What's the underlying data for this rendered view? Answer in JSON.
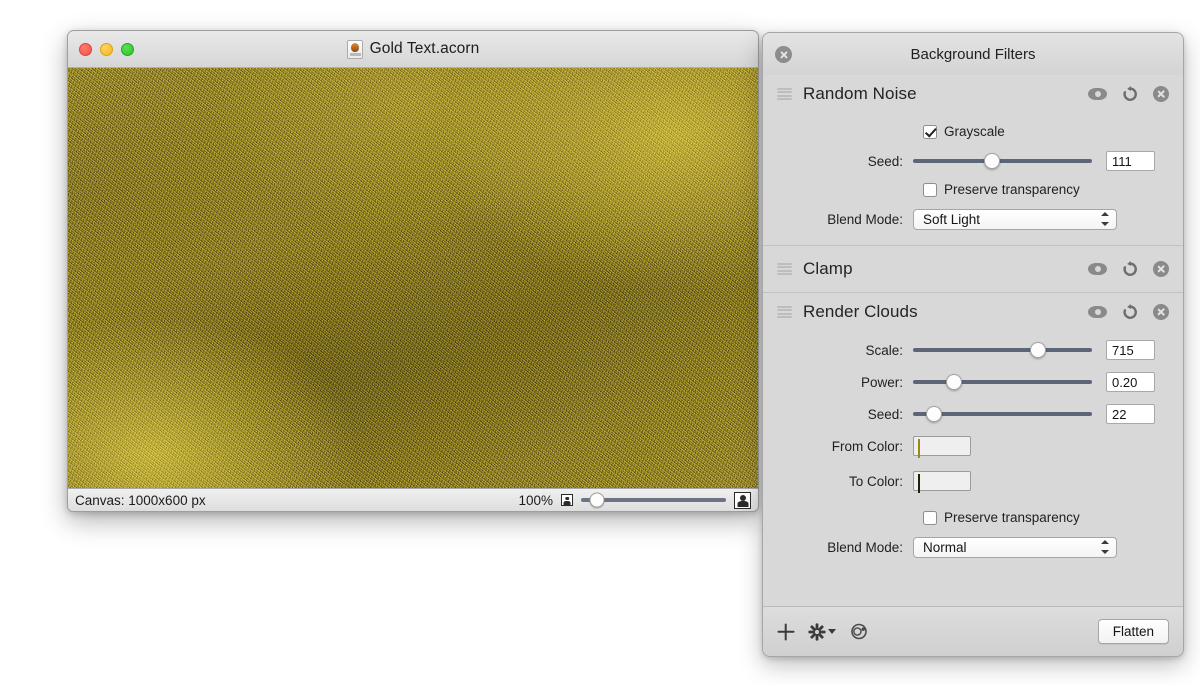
{
  "document_window": {
    "title": "Gold Text.acorn",
    "icon": "acorn-document-icon",
    "traffic_lights": [
      "close",
      "minimize",
      "maximize"
    ],
    "status_bar": {
      "canvas_label": "Canvas: 1000x600 px",
      "zoom_level": "100%",
      "zoom_slider_percent": 11,
      "small_icon": "small-image-icon",
      "large_icon": "large-image-icon"
    }
  },
  "filters_panel": {
    "title": "Background Filters",
    "close_icon": "close-icon",
    "filters": [
      {
        "name": "Random Noise",
        "actions": [
          "eye-icon",
          "revert-icon",
          "delete-icon"
        ],
        "controls": {
          "grayscale": {
            "label": "Grayscale",
            "checked": true
          },
          "seed": {
            "label": "Seed:",
            "value": "111",
            "slider_percent": 44
          },
          "preserve_transparency": {
            "label": "Preserve transparency",
            "checked": false
          },
          "blend_mode": {
            "label": "Blend Mode:",
            "value": "Soft Light"
          }
        }
      },
      {
        "name": "Clamp",
        "actions": [
          "eye-icon",
          "revert-icon",
          "delete-icon"
        ],
        "controls": {}
      },
      {
        "name": "Render Clouds",
        "actions": [
          "eye-icon",
          "revert-icon",
          "delete-icon"
        ],
        "controls": {
          "scale": {
            "label": "Scale:",
            "value": "715",
            "slider_percent": 70
          },
          "power": {
            "label": "Power:",
            "value": "0.20",
            "slider_percent": 23
          },
          "seed": {
            "label": "Seed:",
            "value": "22",
            "slider_percent": 12
          },
          "from_color": {
            "label": "From Color:",
            "color": "#f3cf2e"
          },
          "to_color": {
            "label": "To Color:",
            "color": "#3b3208"
          },
          "preserve_transparency": {
            "label": "Preserve transparency",
            "checked": false
          },
          "blend_mode": {
            "label": "Blend Mode:",
            "value": "Normal"
          }
        }
      }
    ],
    "footer": {
      "add_icon": "plus-icon",
      "settings_icon": "gear-icon",
      "presets_icon": "color-presets-icon",
      "flatten_label": "Flatten"
    }
  },
  "colors": {
    "panel_background": "#d8d8d8",
    "canvas_gold": "#8b7b22",
    "canvas_gold_light": "#d6c140",
    "slider_track": "#5d6578"
  }
}
